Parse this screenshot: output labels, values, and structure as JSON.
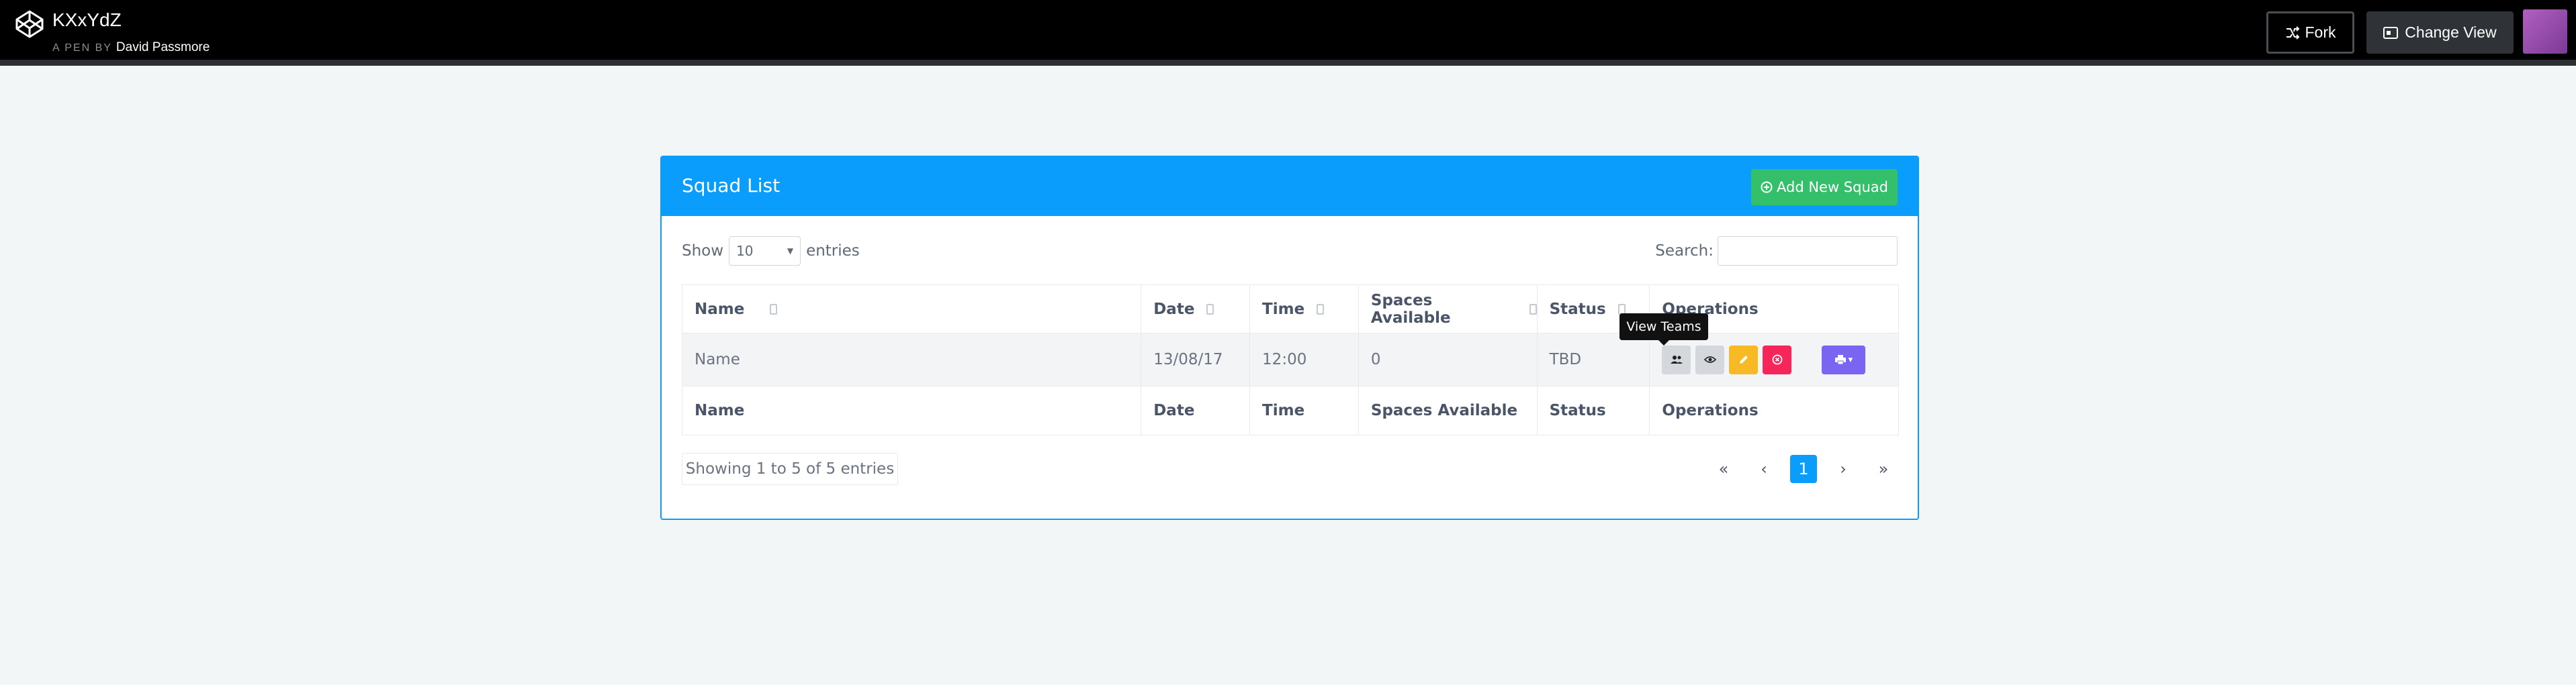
{
  "header": {
    "title": "KXxYdZ",
    "by_prefix": "A PEN BY",
    "author": "David Passmore",
    "fork_label": "Fork",
    "change_view_label": "Change View"
  },
  "card": {
    "title": "Squad List",
    "add_button": "Add New Squad"
  },
  "controls": {
    "show_label": "Show",
    "entries_value": "10",
    "entries_label": "entries",
    "search_label": "Search:",
    "search_value": ""
  },
  "table": {
    "columns": [
      "Name",
      "Date",
      "Time",
      "Spaces Available",
      "Status",
      "Operations"
    ],
    "rows": [
      {
        "name": "Name",
        "date": "13/08/17",
        "time": "12:00",
        "spaces": "0",
        "status": "TBD"
      }
    ]
  },
  "tooltip": "View Teams",
  "footer": {
    "info": "Showing 1 to 5 of 5 entries",
    "pager": {
      "first": "«",
      "prev": "‹",
      "current": "1",
      "next": "›",
      "last": "»"
    }
  },
  "colors": {
    "primary": "#0a9dfb",
    "success": "#34c06a",
    "warning": "#f7b924",
    "danger": "#f6265a",
    "print": "#7a64f2"
  }
}
